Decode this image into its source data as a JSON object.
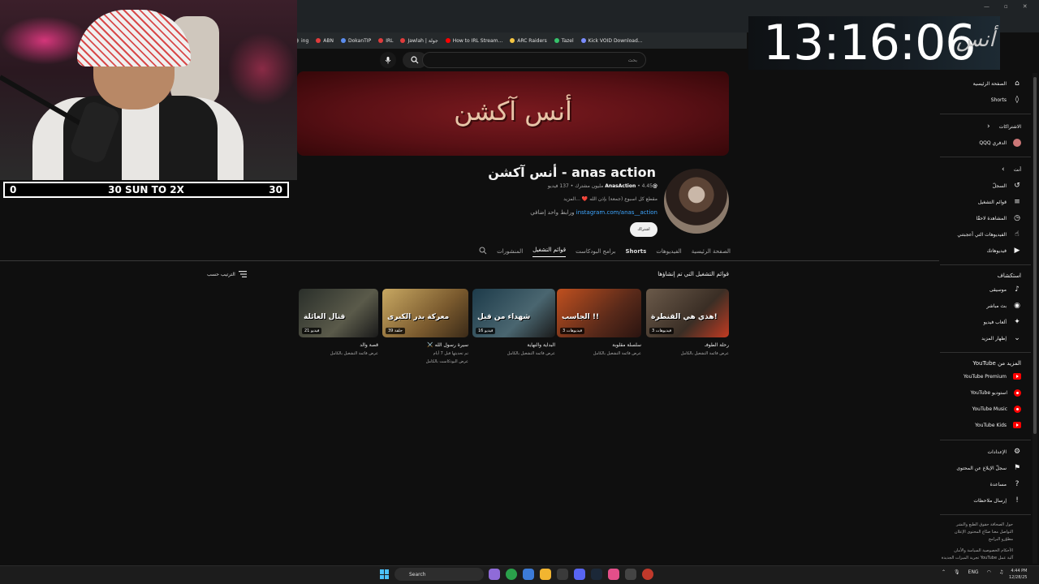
{
  "bookmarks": [
    {
      "label": "ing",
      "color": "#888888"
    },
    {
      "label": "ABN",
      "color": "#e03c3c"
    },
    {
      "label": "DokanTIP",
      "color": "#5b8def"
    },
    {
      "label": "IRL",
      "color": "#e03c3c"
    },
    {
      "label": "Jawlah | جولة",
      "color": "#e03c3c"
    },
    {
      "label": "How to IRL Stream...",
      "color": "#ff0000"
    },
    {
      "label": "ARC Raiders",
      "color": "#f5c542"
    },
    {
      "label": "Tazel",
      "color": "#36c26b"
    },
    {
      "label": "Kick VOID Download...",
      "color": "#7a8cff"
    }
  ],
  "search": {
    "placeholder": "بحث"
  },
  "channel": {
    "banner_title": "أنس آكشن",
    "name": "anas action - أنس آكشن",
    "handle": "@AnasAction",
    "stats": "• 4.45 مليون مشترك • 137 فيديو",
    "description": "مقطع كل اسبوع (جمعة) بإذن الله ❤️ ...المزيد",
    "link_url": "instagram.com/anas__action",
    "link_suffix": "ورابط واحد إضافي",
    "subscribe_label": "اشتراك"
  },
  "tabs": {
    "home": "الصفحة الرئيسية",
    "videos": "الفيديوهات",
    "shorts": "Shorts",
    "podcasts": "برامج البودكاست",
    "playlists": "قوائم التشغيل",
    "posts": "المنشورات"
  },
  "content": {
    "section_title": "قوائم التشغيل التي تم إنشاؤها",
    "sort_label": "الترتيب حسب"
  },
  "playlists": [
    {
      "title": "رحلة الطوفـ",
      "sub": "عرض قائمة التشغيل بالكامل",
      "sub2": "",
      "badge": "3 فيديوهات",
      "overlay": "هذي هي القنطرة!"
    },
    {
      "title": "سلسلة مقلوبة",
      "sub": "عرض قائمة التشغيل بالكامل",
      "sub2": "",
      "badge": "3 فيديوهات",
      "overlay": "الجاسب !!"
    },
    {
      "title": "البداية والنهاية",
      "sub": "عرض قائمة التشغيل بالكامل",
      "sub2": "",
      "badge": "16 فيديو",
      "overlay": "شهداء من قبل"
    },
    {
      "title": "سيرة رسول الله ⚔️",
      "sub": "تم تحديثها قبل 7 أيام",
      "sub2": "عرض البودكاست بالكامل",
      "badge": "39 حلقة",
      "overlay": "معركة بدر الكبرى"
    },
    {
      "title": "قصة والد",
      "sub": "عرض قائمة التشغيل بالكامل",
      "sub2": "",
      "badge": "21 فيديو",
      "overlay": "قتال العائلة"
    }
  ],
  "sidebar": {
    "home": "الصفحة الرئيسية",
    "shorts": "Shorts",
    "subscriptions": "الاشتراكات",
    "sub_channel": "الدفري QQQ",
    "you": "أنت",
    "history": "السجلّ",
    "playlists": "قوائم التشغيل",
    "watch_later": "المشاهدة لاحقًا",
    "liked": "الفيديوهات التي أعجبتني",
    "your_videos": "فيديوهاتك",
    "explore": "استكشاف",
    "music": "موسيقى",
    "live": "بث مباشر",
    "gaming": "ألعاب فيديو",
    "show_more": "إظهار المزيد",
    "more_from": "المزيد من YouTube",
    "premium": "YouTube Premium",
    "studio": "استوديو YouTube",
    "yt_music": "YouTube Music",
    "kids": "YouTube Kids",
    "settings": "الإعدادات",
    "report": "سجلّ الإبلاغ عن المحتوى",
    "help": "مساعدة",
    "feedback": "إرسال ملاحظات",
    "footer1": "حول  الصحافة  حقوق الطبع والنشر",
    "footer2": "التواصل معنا  صنّاع المحتوى  الإعلان",
    "footer3": "مطوّرو البرامج",
    "footer4": "الأحكام  الخصوصية  السياسة والأمان",
    "footer5": "آلية عمل YouTube  تجربة الميزات الجديدة"
  },
  "overlay": {
    "score_left": "0",
    "score_center": "30 SUN TO 2X",
    "score_right": "30",
    "clock": "13:16:06",
    "clock_logo": "أنس"
  },
  "taskbar": {
    "search_label": "Search",
    "lang": "ENG",
    "time": "4:44 PM",
    "date": "12/28/25"
  },
  "colors": {
    "background": "#0f0f0f",
    "accent_link": "#3ea6ff",
    "youtube_red": "#ff0000"
  }
}
